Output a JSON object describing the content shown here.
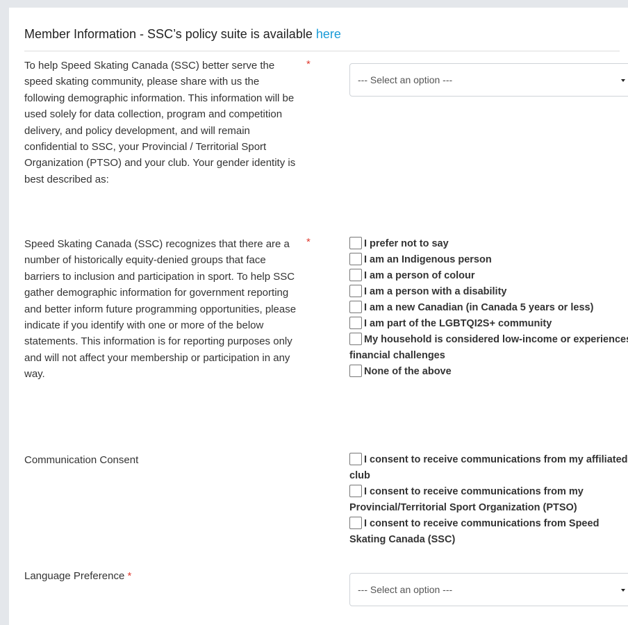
{
  "section": {
    "title": "Member Information - SSC’s policy suite is available ",
    "title_link": "here"
  },
  "gender": {
    "label": "To help Speed Skating Canada (SSC) better serve the speed skating community, please share with us the following demographic information. This information will be used solely for data collection, program and competition delivery, and policy development, and will remain confidential to SSC, your Provincial / Territorial Sport Organization (PTSO) and your club. Your gender identity is best described as:",
    "required": "*",
    "select_value": "--- Select an option ---"
  },
  "equity": {
    "label": "Speed Skating Canada (SSC) recognizes that there are a number of historically equity-denied groups that face barriers to inclusion and participation in sport. To help SSC gather demographic information for government reporting and better inform future programming opportunities, please indicate if you identify with one or more of the below statements. This information is for reporting purposes only and will not affect your membership or participation in any way.",
    "required": "*",
    "options": [
      "I prefer not to say",
      "I am an Indigenous person",
      "I am a person of colour",
      "I am a person with a disability",
      "I am a new Canadian (in Canada 5 years or less)",
      "I am part of the LGBTQI2S+ community",
      "My household is considered low-income or experiences financial challenges",
      "None of the above"
    ]
  },
  "consent": {
    "label": "Communication Consent",
    "options": [
      "I consent to receive communications from my affiliated club",
      "I consent to receive communications from my Provincial/Territorial Sport Organization (PTSO)",
      "I consent to receive communications from Speed Skating Canada (SSC)"
    ]
  },
  "language": {
    "label": "Language Preference ",
    "required": "*",
    "select_value": "--- Select an option ---"
  }
}
